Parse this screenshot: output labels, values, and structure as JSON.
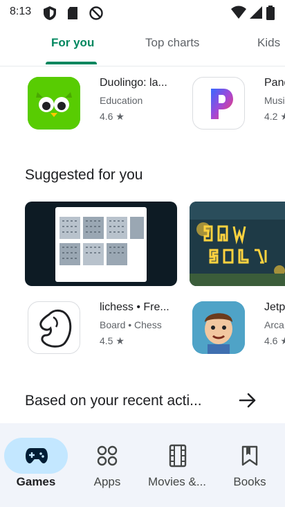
{
  "status_bar": {
    "time": "8:13"
  },
  "top_tabs": [
    {
      "label": "For you",
      "active": true
    },
    {
      "label": "Top charts",
      "active": false
    },
    {
      "label": "Kids",
      "active": false
    }
  ],
  "top_row": [
    {
      "title": "Duolingo: la...",
      "category": "Education",
      "rating": "4.6 ★",
      "icon": "duolingo-owl-icon"
    },
    {
      "title": "Pand",
      "category": "Musi",
      "rating": "4.2 ★",
      "icon": "pandora-icon"
    }
  ],
  "suggested": {
    "title": "Suggested for you",
    "apps": [
      {
        "title": "lichess • Fre...",
        "category": "Board  •  Chess",
        "rating": "4.5 ★",
        "icon": "lichess-knight-icon"
      },
      {
        "title": "Jetp",
        "category": "Arca",
        "rating": "4.6 ★",
        "icon": "jetpack-joyride-icon"
      }
    ]
  },
  "recent": {
    "title": "Based on your recent acti..."
  },
  "bottom_nav": [
    {
      "label": "Games",
      "active": true,
      "icon": "gamepad-icon"
    },
    {
      "label": "Apps",
      "active": false,
      "icon": "apps-grid-icon"
    },
    {
      "label": "Movies &...",
      "active": false,
      "icon": "film-icon"
    },
    {
      "label": "Books",
      "active": false,
      "icon": "bookmark-icon"
    }
  ],
  "colors": {
    "accent": "#01875f",
    "nav_pill": "#c3e7ff",
    "nav_bg": "#f1f4fa"
  }
}
